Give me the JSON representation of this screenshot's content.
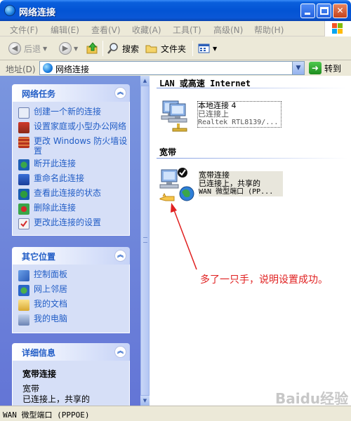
{
  "window": {
    "title": "网络连接",
    "colors": {
      "title_bar": "#0354d4",
      "task_pane_link": "#215dc6",
      "annotation": "#e02020"
    }
  },
  "menu": [
    "文件(F)",
    "编辑(E)",
    "查看(V)",
    "收藏(A)",
    "工具(T)",
    "高级(N)",
    "帮助(H)"
  ],
  "toolbar": {
    "back": "后退",
    "search": "搜索",
    "folders": "文件夹"
  },
  "address": {
    "label": "地址(D)",
    "value": "网络连接",
    "go": "转到"
  },
  "panels": {
    "tasks": {
      "title": "网络任务",
      "items": [
        {
          "label": "创建一个新的连接",
          "icon": "new-connection-icon"
        },
        {
          "label": "设置家庭或小型办公网络",
          "icon": "home-network-icon"
        },
        {
          "label": "更改 Windows 防火墙设置",
          "icon": "firewall-icon"
        },
        {
          "label": "断开此连接",
          "icon": "disconnect-icon"
        },
        {
          "label": "重命名此连接",
          "icon": "rename-icon"
        },
        {
          "label": "查看此连接的状态",
          "icon": "status-icon"
        },
        {
          "label": "删除此连接",
          "icon": "delete-icon"
        },
        {
          "label": "更改此连接的设置",
          "icon": "settings-icon"
        }
      ]
    },
    "places": {
      "title": "其它位置",
      "items": [
        {
          "label": "控制面板",
          "icon": "control-panel-icon"
        },
        {
          "label": "网上邻居",
          "icon": "network-places-icon"
        },
        {
          "label": "我的文档",
          "icon": "my-documents-icon"
        },
        {
          "label": "我的电脑",
          "icon": "my-computer-icon"
        }
      ]
    },
    "details": {
      "title": "详细信息",
      "name": "宽带连接",
      "type": "宽带",
      "status": "已连接上，共享的"
    }
  },
  "groups": {
    "lan": {
      "title": "LAN 或高速 Internet",
      "connection": {
        "name": "本地连接 4",
        "status": "已连接上",
        "device": "Realtek RTL8139/..."
      }
    },
    "broadband": {
      "title": "宽带",
      "connection": {
        "name": "宽带连接",
        "status": "已连接上，共享的",
        "device": "WAN 微型端口 (PP..."
      }
    }
  },
  "annotation": "多了一只手，说明设置成功。",
  "statusbar": "WAN 微型端口 (PPPOE)",
  "watermark": "Baidu经验"
}
